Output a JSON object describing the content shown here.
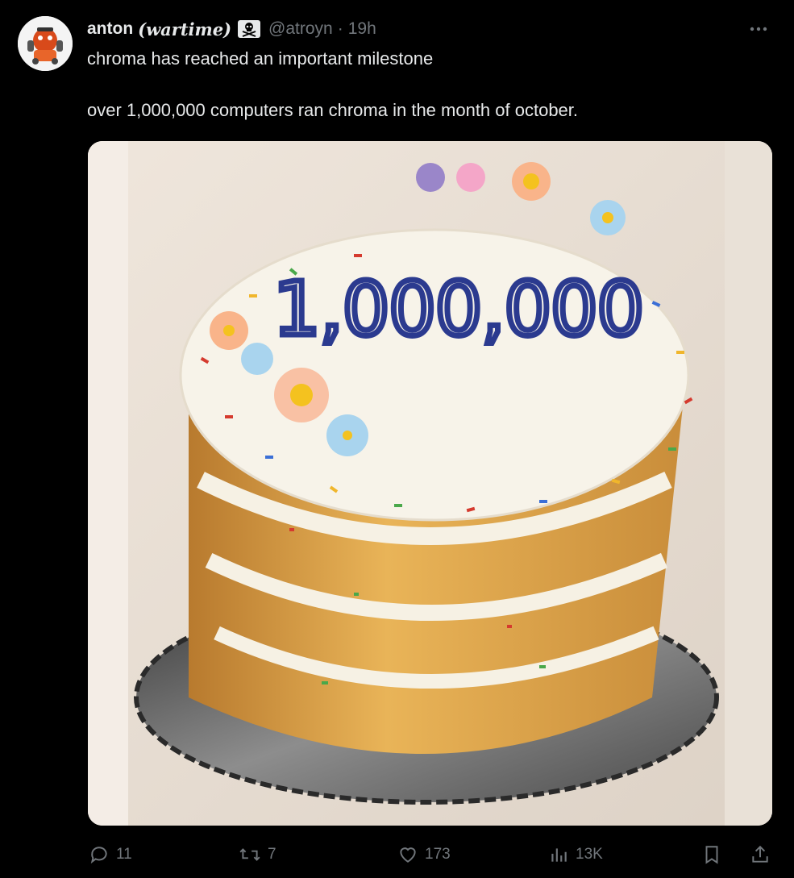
{
  "tweet": {
    "display_name": "anton",
    "display_name_suffix": "(wartime)",
    "badge_icon": "skull-crossbones-icon",
    "handle": "@atroyn",
    "separator": "·",
    "time": "19h",
    "more_icon": "more-icon",
    "text_line_1": "chroma has reached an important milestone",
    "text_line_2": "over 1,000,000 computers ran chroma in the month of october.",
    "image": {
      "cake_text": "1,000,000"
    }
  },
  "actions": {
    "replies": "11",
    "reposts": "7",
    "likes": "173",
    "views": "13K"
  },
  "colors": {
    "background": "#000000",
    "text_primary": "#e7e9ea",
    "text_secondary": "#71767b",
    "frosting": "#f7f3e9",
    "piping": "#2b3a8f",
    "cake": "#e5a64a"
  }
}
